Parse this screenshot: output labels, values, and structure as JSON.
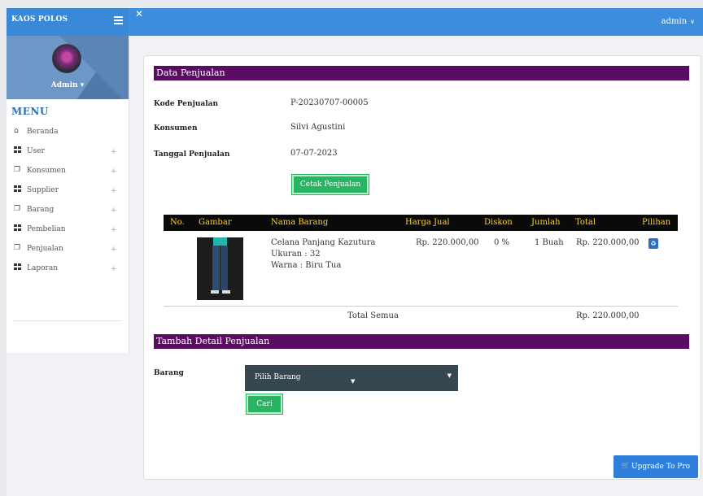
{
  "topbar": {
    "brand": "KAOS POLOS",
    "user": "admin"
  },
  "sidebar": {
    "profile_name": "Admin",
    "menu_heading": "MENU",
    "items": [
      {
        "label": "Beranda",
        "icon": "home-icon",
        "expandable": false
      },
      {
        "label": "User",
        "icon": "grid-icon",
        "expandable": true
      },
      {
        "label": "Konsumen",
        "icon": "copy-icon",
        "expandable": true
      },
      {
        "label": "Supplier",
        "icon": "grid-icon",
        "expandable": true
      },
      {
        "label": "Barang",
        "icon": "copy-icon",
        "expandable": true
      },
      {
        "label": "Pembelian",
        "icon": "grid-icon",
        "expandable": true
      },
      {
        "label": "Penjualan",
        "icon": "copy-icon",
        "expandable": true
      },
      {
        "label": "Laporan",
        "icon": "grid-icon",
        "expandable": true
      }
    ],
    "plus": "+"
  },
  "sale": {
    "section_title": "Data Penjualan",
    "kode_label": "Kode Penjualan",
    "kode_value": "P-20230707-00005",
    "konsumen_label": "Konsumen",
    "konsumen_value": "Silvi Agustini",
    "tanggal_label": "Tanggal Penjualan",
    "tanggal_value": "07-07-2023",
    "print_button": "Cetak Penjualan"
  },
  "table": {
    "headers": [
      "No.",
      "Gambar",
      "Nama Barang",
      "Harga Jual",
      "Diskon",
      "Jumlah",
      "Total",
      "Pilihan"
    ],
    "rows": [
      {
        "name": "Celana Panjang Kazutura",
        "size": "Ukuran : 32",
        "color": "Warna : Biru Tua",
        "price": "Rp. 220.000,00",
        "discount": "0 %",
        "qty": "1 Buah",
        "total": "Rp. 220.000,00"
      }
    ],
    "total_label": "Total Semua",
    "total_value": "Rp. 220.000,00"
  },
  "add_detail": {
    "section_title": "Tambah Detail Penjualan",
    "barang_label": "Barang",
    "select_value": "Pilih Barang",
    "search_button": "Cari"
  },
  "upgrade": {
    "label": "Upgrade To Pro"
  },
  "colors": {
    "topbar": "#3c8dde",
    "section_bar": "#5a0c63",
    "table_header_text": "#ffd42a",
    "button_green": "#28b463"
  }
}
